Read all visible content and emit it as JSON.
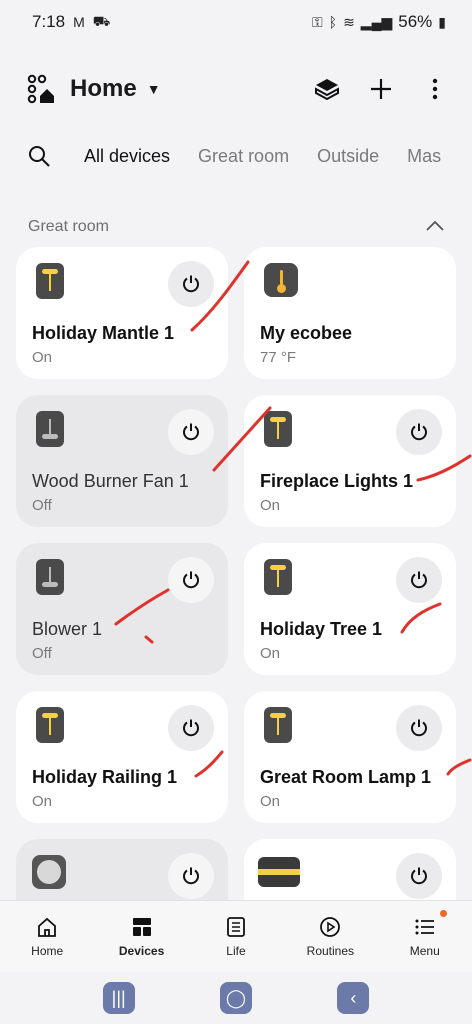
{
  "status_bar": {
    "time": "7:18",
    "battery": "56%"
  },
  "header": {
    "title": "Home"
  },
  "tabs": [
    {
      "label": "All devices"
    },
    {
      "label": "Great room"
    },
    {
      "label": "Outside"
    },
    {
      "label": "Mas"
    }
  ],
  "section": {
    "title": "Great room"
  },
  "devices": [
    {
      "name": "Holiday Mantle 1",
      "state": "On"
    },
    {
      "name": "My ecobee",
      "state": "77 °F"
    },
    {
      "name": "Wood Burner Fan 1",
      "state": "Off"
    },
    {
      "name": "Fireplace Lights 1",
      "state": "On"
    },
    {
      "name": "Blower 1",
      "state": "Off"
    },
    {
      "name": "Holiday Tree 1",
      "state": "On"
    },
    {
      "name": "Holiday Railing 1",
      "state": "On"
    },
    {
      "name": "Great Room Lamp 1",
      "state": "On"
    }
  ],
  "bottom_nav": [
    {
      "label": "Home",
      "icon": "home-icon"
    },
    {
      "label": "Devices",
      "icon": "devices-icon"
    },
    {
      "label": "Life",
      "icon": "life-icon"
    },
    {
      "label": "Routines",
      "icon": "routines-icon"
    },
    {
      "label": "Menu",
      "icon": "menu-icon"
    }
  ],
  "colors": {
    "accent_yellow": "#f7d13e",
    "annotation_red": "#e0322b",
    "badge_orange": "#f26522"
  }
}
